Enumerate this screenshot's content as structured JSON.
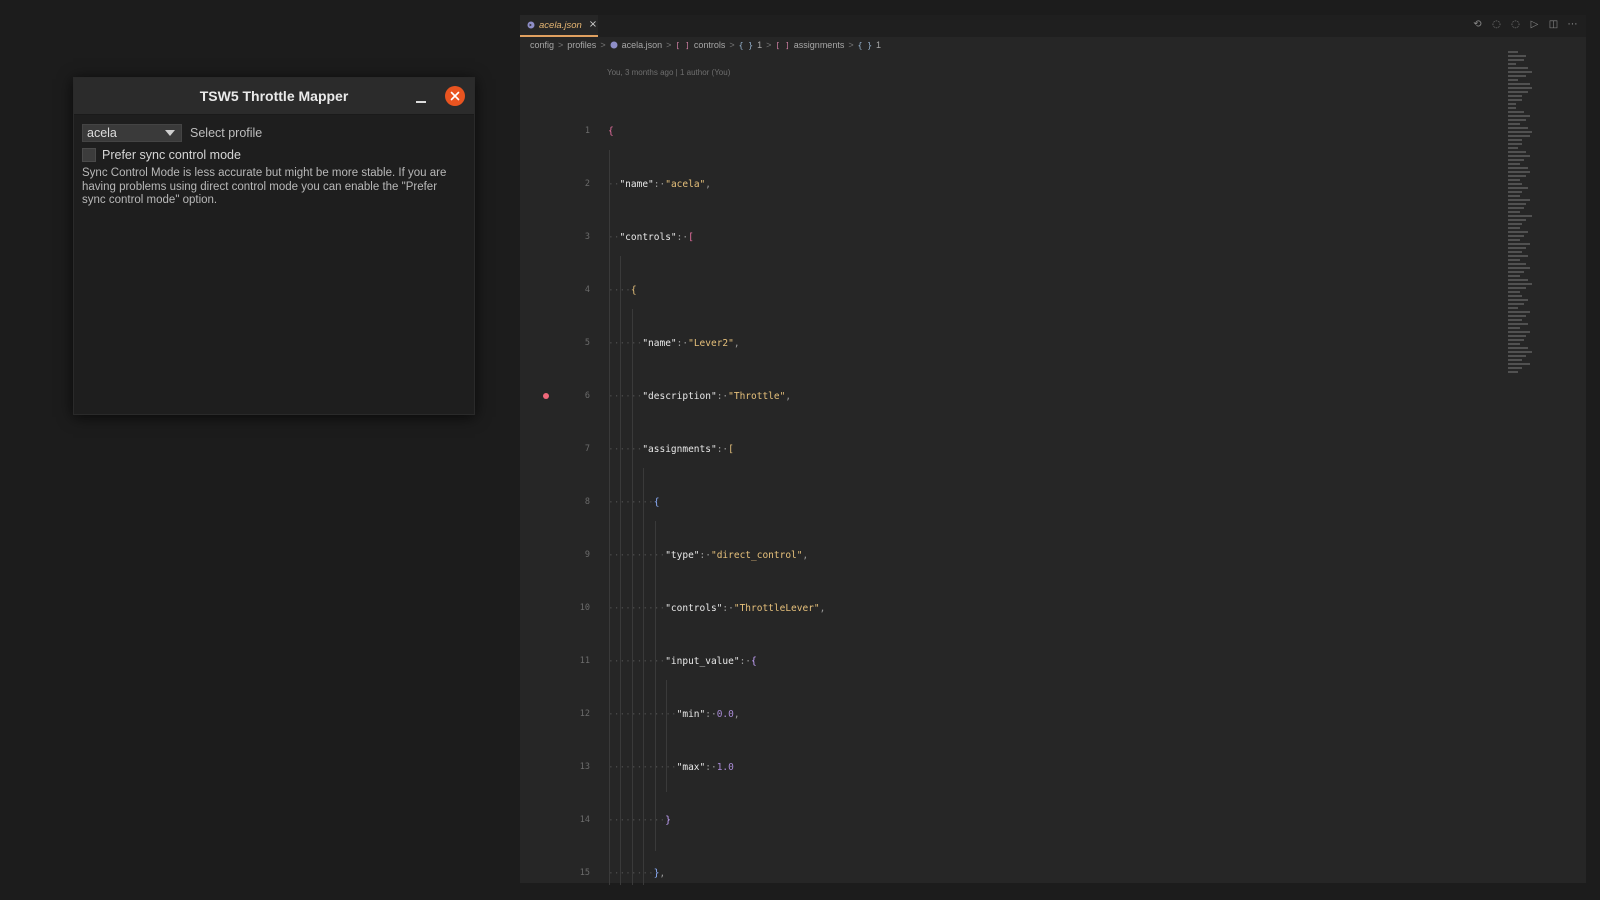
{
  "dialog": {
    "title": "TSW5 Throttle Mapper",
    "profile_value": "acela",
    "profile_label": "Select profile",
    "checkbox_label": "Prefer sync control mode",
    "help_text": "Sync Control Mode is less accurate but might be more stable. If you are having problems using direct control mode you can enable the \"Prefer sync control mode\" option."
  },
  "editor": {
    "tab_label": "acela.json",
    "tab_close": "×",
    "breadcrumb": {
      "config": "config",
      "profiles": "profiles",
      "file": "acela.json",
      "controls_sym": "[ ]",
      "controls": "controls",
      "item1_sym": "{ }",
      "item1": "1",
      "assignments_sym": "[ ]",
      "assignments": "assignments",
      "item2_sym": "{ }",
      "item2": "1",
      "sep": ">"
    },
    "blame": "You, 3 months ago | 1 author (You)",
    "line_numbers": [
      "1",
      "2",
      "3",
      "4",
      "5",
      "6",
      "7",
      "8",
      "9",
      "10",
      "11",
      "12",
      "13",
      "14",
      "15"
    ],
    "lines": {
      "l1_open": "{",
      "l2_key": "\"name\"",
      "l2_val": "\"acela\"",
      "l3_key": "\"controls\"",
      "l3_open": "[",
      "l4_open": "{",
      "l5_key": "\"name\"",
      "l5_val": "\"Lever2\"",
      "l6_key": "\"description\"",
      "l6_val": "\"Throttle\"",
      "l7_key": "\"assignments\"",
      "l7_open": "[",
      "l8_open": "{",
      "l9_key": "\"type\"",
      "l9_val": "\"direct_control\"",
      "l10_key": "\"controls\"",
      "l10_val": "\"ThrottleLever\"",
      "l11_key": "\"input_value\"",
      "l11_open": "{",
      "l12_key": "\"min\"",
      "l12_val": "0.0",
      "l13_key": "\"max\"",
      "l13_val": "1.0",
      "l14_close": "}",
      "l15_close": "}"
    }
  },
  "colors": {
    "accent": "#e95420",
    "tab_text": "#e6b673",
    "string": "#e6c07b",
    "number": "#a98bd6",
    "breakpoint": "#f0687a"
  }
}
